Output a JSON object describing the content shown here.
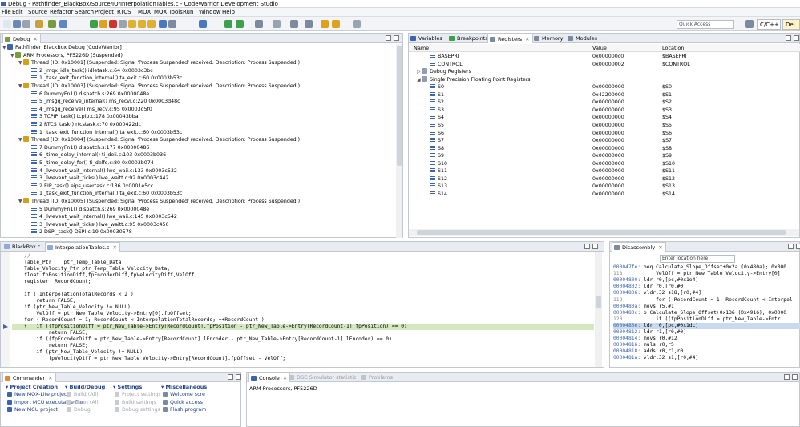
{
  "window": {
    "title": "Debug - Pathfinder_BlackBox/Source/IO/InterpolationTables.c - CodeWarrior Development Studio"
  },
  "menu": [
    "File",
    "Edit",
    "Source",
    "Refactor",
    "Search",
    "Project",
    "RTCS",
    "MQX",
    "MQX Tools",
    "Run",
    "Window",
    "Help"
  ],
  "toolbar": {
    "quick_access_placeholder": "Quick Access",
    "perspective_cc": "C/C++",
    "perspective_debug": "Del"
  },
  "debug_view": {
    "tab": "Debug",
    "rows": [
      {
        "indent": 0,
        "exp": "▼",
        "icon": "project",
        "text": "Pathfinder_BlackBox Debug [CodeWarrior]"
      },
      {
        "indent": 1,
        "exp": "▼",
        "icon": "process",
        "text": "ARM Processors, PF5226D (Suspended)"
      },
      {
        "indent": 2,
        "exp": "▼",
        "icon": "thread",
        "text": "Thread [ID: 0x10001] (Suspended: Signal 'Process Suspended' received. Description: Process Suspended.)"
      },
      {
        "indent": 3,
        "exp": "",
        "icon": "frame",
        "text": "2 _mqx_idle_task() idletask.c:64 0x0003c3bc"
      },
      {
        "indent": 3,
        "exp": "",
        "icon": "frame",
        "text": "1 _task_exit_function_internal() ta_exit.c:60 0x0003b53c"
      },
      {
        "indent": 2,
        "exp": "▼",
        "icon": "thread",
        "text": "Thread [ID: 0x10003] (Suspended: Signal 'Process Suspended' received. Description: Process Suspended.)"
      },
      {
        "indent": 3,
        "exp": "",
        "icon": "frame",
        "text": "6 DummyFn1() dispatch.s:269 0x0000048e"
      },
      {
        "indent": 3,
        "exp": "",
        "icon": "frame",
        "text": "5 _msgq_receive_internal() ms_recvi.c:220 0x0003d48c"
      },
      {
        "indent": 3,
        "exp": "",
        "icon": "frame",
        "text": "4 _msgq_receive() ms_recv.c:95 0x0003d5f0"
      },
      {
        "indent": 3,
        "exp": "",
        "icon": "frame",
        "text": "3 TCPIP_task() tcpip.c:178 0x00043bba"
      },
      {
        "indent": 3,
        "exp": "",
        "icon": "frame",
        "text": "2 RTCS_task() rtcstask.c:70 0x000422dc"
      },
      {
        "indent": 3,
        "exp": "",
        "icon": "frame",
        "text": "1 _task_exit_function_internal() ta_exit.c:60 0x0003b53c"
      },
      {
        "indent": 2,
        "exp": "▼",
        "icon": "thread",
        "text": "Thread [ID: 0x10004] (Suspended: Signal 'Process Suspended' received. Description: Process Suspended.)"
      },
      {
        "indent": 3,
        "exp": "",
        "icon": "frame",
        "text": "7 DummyFn1() dispatch.s:177 0x00000486"
      },
      {
        "indent": 3,
        "exp": "",
        "icon": "frame",
        "text": "6 _time_delay_internal() ti_deli.c:103 0x0003b036"
      },
      {
        "indent": 3,
        "exp": "",
        "icon": "frame",
        "text": "5 _time_delay_for() ti_delfo.c:80 0x0003b074"
      },
      {
        "indent": 3,
        "exp": "",
        "icon": "frame",
        "text": "4 _lwevent_wait_internal() lwe_waii.c:133 0x0003c532"
      },
      {
        "indent": 3,
        "exp": "",
        "icon": "frame",
        "text": "3 _lwevent_wait_ticks() lwe_waitt.c:92 0x0003c442"
      },
      {
        "indent": 3,
        "exp": "",
        "icon": "frame",
        "text": "2 EIP_task() eips_usertask.c:136 0x0001e5cc"
      },
      {
        "indent": 3,
        "exp": "",
        "icon": "frame",
        "text": "1 _task_exit_function_internal() ta_exit.c:60 0x0003b53c"
      },
      {
        "indent": 2,
        "exp": "▼",
        "icon": "thread",
        "text": "Thread [ID: 0x10005] (Suspended: Signal 'Process Suspended' received. Description: Process Suspended.)"
      },
      {
        "indent": 3,
        "exp": "",
        "icon": "frame",
        "text": "5 DummyFn1() dispatch.s:269 0x0000048e"
      },
      {
        "indent": 3,
        "exp": "",
        "icon": "frame",
        "text": "4 _lwevent_wait_internal() lwe_waii.c:145 0x0003c542"
      },
      {
        "indent": 3,
        "exp": "",
        "icon": "frame",
        "text": "3 _lwevent_wait_ticks() lwe_waitt.c:95 0x0003c456"
      },
      {
        "indent": 3,
        "exp": "",
        "icon": "frame",
        "text": "2 DSPI_task() DSPI.c:19 0x00030578"
      }
    ]
  },
  "registers_view": {
    "tabs": [
      "Variables",
      "Breakpoints",
      "Registers",
      "Memory",
      "Modules"
    ],
    "columns": [
      "Name",
      "Value",
      "Location"
    ],
    "rows": [
      {
        "indent": 2,
        "group": false,
        "name": "BASEPRI",
        "value": "0x000000c0",
        "location": "$BASEPRI"
      },
      {
        "indent": 2,
        "group": false,
        "name": "CONTROL",
        "value": "0x00000002",
        "location": "$CONTROL"
      },
      {
        "indent": 0,
        "group": true,
        "exp": "▷",
        "name": "Debug Registers",
        "value": "",
        "location": ""
      },
      {
        "indent": 0,
        "group": true,
        "exp": "◢",
        "name": "Single Precision Floating Point Registers",
        "value": "",
        "location": ""
      },
      {
        "indent": 2,
        "group": false,
        "name": "S0",
        "value": "0x00000000",
        "location": "$S0"
      },
      {
        "indent": 2,
        "group": false,
        "name": "S1",
        "value": "0x42200000",
        "location": "$S1"
      },
      {
        "indent": 2,
        "group": false,
        "name": "S2",
        "value": "0x00000000",
        "location": "$S2"
      },
      {
        "indent": 2,
        "group": false,
        "name": "S3",
        "value": "0x00000000",
        "location": "$S3"
      },
      {
        "indent": 2,
        "group": false,
        "name": "S4",
        "value": "0x00000000",
        "location": "$S4"
      },
      {
        "indent": 2,
        "group": false,
        "name": "S5",
        "value": "0x00000000",
        "location": "$S5"
      },
      {
        "indent": 2,
        "group": false,
        "name": "S6",
        "value": "0x00000000",
        "location": "$S6"
      },
      {
        "indent": 2,
        "group": false,
        "name": "S7",
        "value": "0x00000000",
        "location": "$S7"
      },
      {
        "indent": 2,
        "group": false,
        "name": "S8",
        "value": "0x00000000",
        "location": "$S8"
      },
      {
        "indent": 2,
        "group": false,
        "name": "S9",
        "value": "0x00000000",
        "location": "$S9"
      },
      {
        "indent": 2,
        "group": false,
        "name": "S10",
        "value": "0x00000000",
        "location": "$S10"
      },
      {
        "indent": 2,
        "group": false,
        "name": "S11",
        "value": "0x00000000",
        "location": "$S11"
      },
      {
        "indent": 2,
        "group": false,
        "name": "S12",
        "value": "0x00000000",
        "location": "$S12"
      },
      {
        "indent": 2,
        "group": false,
        "name": "S13",
        "value": "0x00000000",
        "location": "$S13"
      },
      {
        "indent": 2,
        "group": false,
        "name": "S14",
        "value": "0x00000000",
        "location": "$S14"
      }
    ]
  },
  "editor": {
    "tabs": [
      "BlackBox.c",
      "InterpolationTables.c"
    ],
    "active_line": 11,
    "lines": [
      "    //-------------------------------------------------------------------------",
      "    Table_Ptr    ptr_Temp_Table_Data;",
      "    Table_Velocity_Ptr ptr_Temp_Table_Velocity_Data;",
      "    float fpPositionDiff,fpEncoderDiff,fpVelocityDiff,VelOff;",
      "    register  RecordCount;",
      "",
      "    if ( InterpolationTotalRecords < 2 )",
      "        return FALSE;",
      "    if (ptr_New_Table_Velocity != NULL)",
      "        VelOff = ptr_New_Table_Velocity->Entry[0].fpOffset;",
      "    for ( RecordCount = 1; RecordCount < InterpolationTotalRecords; ++RecordCount )",
      "    {   if ((fpPositionDiff = ptr_New_Table->Entry[RecordCount].fpPosition - ptr_New_Table->Entry[RecordCount-1].fpPosition) == 0)",
      "            return FALSE;",
      "        if ((fpEncoderDiff = ptr_New_Table->Entry[RecordCount].lEncoder - ptr_New_Table->Entry[RecordCount-1].lEncoder) == 0)",
      "            return FALSE;",
      "        if (ptr_New_Table_Velocity != NULL)",
      "            fpVelocityDiff = ptr_New_Table_Velocity->Entry[RecordCount].fpOffset - VelOff;"
    ]
  },
  "disassembly": {
    "tab": "Disassembly",
    "location_placeholder": "Enter location here",
    "lines": [
      {
        "addr": "000047fe:",
        "text": "beq Calculate_Slope_Offset+0x2a (0x480a); 0x000",
        "hl": false
      },
      {
        "addr": "118",
        "text": "    VelOff = ptr_New_Table_Velocity->Entry[0]",
        "hl": false
      },
      {
        "addr": "00004800:",
        "text": "ldr r0,[pc,#0x1e4]",
        "hl": false
      },
      {
        "addr": "00004802:",
        "text": "ldr r0,[r0,#0]",
        "hl": false
      },
      {
        "addr": "00004806:",
        "text": "vldr.32 s18,[r0,#4]",
        "hl": false
      },
      {
        "addr": "119",
        "text": "    for ( RecordCount = 1; RecordCount < Interpol",
        "hl": false
      },
      {
        "addr": "0000480a:",
        "text": "movs r5,#1",
        "hl": false
      },
      {
        "addr": "0000480c:",
        "text": "b Calculate_Slope_Offset+0x136 (0x4916); 0x0000",
        "hl": false
      },
      {
        "addr": "120",
        "text": "    if ((fpPositionDiff = ptr_New_Table->Entr",
        "hl": false
      },
      {
        "addr": "0000480e:",
        "text": "ldr r0,[pc,#0x1dc]",
        "hl": true
      },
      {
        "addr": "00004812:",
        "text": "ldr r1,[r0,#0]",
        "hl": false
      },
      {
        "addr": "00004814:",
        "text": "movs r0,#12",
        "hl": false
      },
      {
        "addr": "00004816:",
        "text": "muls r0,r5",
        "hl": false
      },
      {
        "addr": "00004818:",
        "text": "adds r0,r1,r0",
        "hl": false
      },
      {
        "addr": "0000481a:",
        "text": "vldr.32 s1,[r0,#4]",
        "hl": false
      }
    ]
  },
  "commander": {
    "tab": "Commander",
    "sections": [
      {
        "title": "Project Creation",
        "items": [
          {
            "label": "New MQX-Lite project",
            "dim": false
          },
          {
            "label": "Import MCU executable file",
            "dim": false
          },
          {
            "label": "New MCU project",
            "dim": false
          }
        ]
      },
      {
        "title": "Build/Debug",
        "items": [
          {
            "label": "Build  (All)",
            "dim": true
          },
          {
            "label": "Clean  (All)",
            "dim": true
          },
          {
            "label": "Debug",
            "dim": true
          }
        ]
      },
      {
        "title": "Settings",
        "items": [
          {
            "label": "Project settings",
            "dim": true
          },
          {
            "label": "Build settings",
            "dim": true
          },
          {
            "label": "Debug settings",
            "dim": true
          }
        ]
      },
      {
        "title": "Miscellaneous",
        "items": [
          {
            "label": "Welcome scre",
            "dim": false
          },
          {
            "label": "Quick access",
            "dim": false
          },
          {
            "label": "Flash program",
            "dim": false
          }
        ]
      }
    ]
  },
  "console": {
    "tabs": [
      "Console",
      "DSC Simulator statistic",
      "Problems"
    ],
    "text": "ARM Processors, PF5226D"
  },
  "colors": {
    "accent": "#3c64b0",
    "highlight_line": "#d4e8c0",
    "panel_border": "#c3c7cf",
    "tab_bg": "#e8ebf1"
  }
}
